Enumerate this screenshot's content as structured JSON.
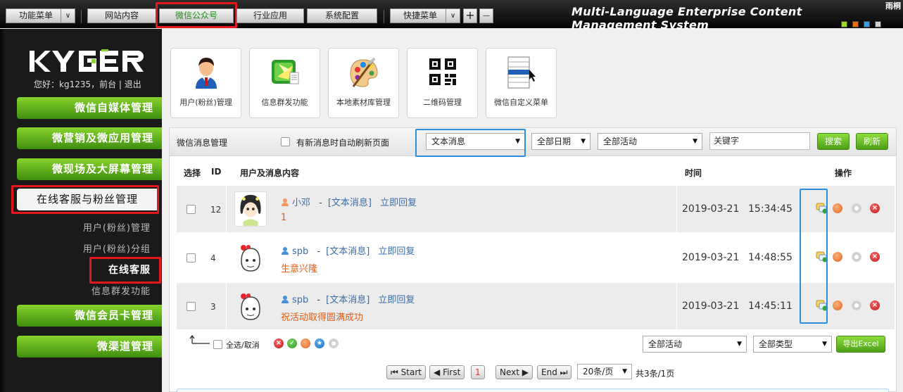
{
  "topbar": {
    "menu_function": "功能菜单",
    "menu_website": "网站内容",
    "menu_wechat": "微信公众号",
    "menu_industry": "行业应用",
    "menu_system": "系统配置",
    "menu_quick": "快捷菜单",
    "plus": "+",
    "minus": "—",
    "caret": "∨",
    "brand_title": "Multi-Language Enterprise Content Management System",
    "brand_corner": "雨桐"
  },
  "sidebar": {
    "greeting": "您好：kg1235，前台 | 退出",
    "sections": [
      "微信自媒体管理",
      "微营销及微应用管理",
      "微现场及大屏幕管理",
      "在线客服与粉丝管理",
      "微信会员卡管理",
      "微渠道管理"
    ],
    "subitems": [
      "用户(粉丝)管理",
      "用户(粉丝)分组",
      "在线客服",
      "信息群发功能"
    ]
  },
  "quick_cards": [
    {
      "label": "用户(粉丝)管理",
      "icon": "user-avatar-icon"
    },
    {
      "label": "信息群发功能",
      "icon": "mass-message-icon"
    },
    {
      "label": "本地素材库管理",
      "icon": "palette-icon"
    },
    {
      "label": "二维码管理",
      "icon": "qrcode-icon"
    },
    {
      "label": "微信自定义菜单",
      "icon": "custom-menu-icon"
    }
  ],
  "panel": {
    "title": "微信消息管理",
    "auto_refresh_label": "有新消息时自动刷新页面",
    "msg_type": "文本消息",
    "date_filter": "全部日期",
    "activity_filter": "全部活动",
    "keyword_placeholder": "关键字",
    "search_label": "搜索",
    "refresh_label": "刷新",
    "headers": {
      "select": "选择",
      "id": "ID",
      "content": "用户及消息内容",
      "time": "时间",
      "actions": "操作"
    },
    "separator": "-",
    "rows": [
      {
        "id": "12",
        "user": "小邓",
        "type": "[文本消息]",
        "reply": "立即回复",
        "message": "1",
        "date": "2019-03-21",
        "time": "15:34:45"
      },
      {
        "id": "4",
        "user": "spb",
        "type": "[文本消息]",
        "reply": "立即回复",
        "message": "生意兴隆",
        "date": "2019-03-21",
        "time": "14:48:55"
      },
      {
        "id": "3",
        "user": "spb",
        "type": "[文本消息]",
        "reply": "立即回复",
        "message": "祝活动取得圆满成功",
        "date": "2019-03-21",
        "time": "14:45:11"
      }
    ],
    "select_all_label": "全选/取消",
    "footer_activity": "全部活动",
    "footer_type": "全部类型",
    "export_label": "导出Excel"
  },
  "pagination": {
    "start": "Start",
    "first": "First",
    "current": "1",
    "next": "Next",
    "end": "End",
    "per_page": "20条/页",
    "summary": "共3条/1页"
  },
  "colors": {
    "accent_green": "#4c9f17",
    "highlight_red": "#e3171c",
    "highlight_blue": "#2a8fe1",
    "link_blue": "#3b6da9",
    "message_orange": "#e05d14"
  }
}
